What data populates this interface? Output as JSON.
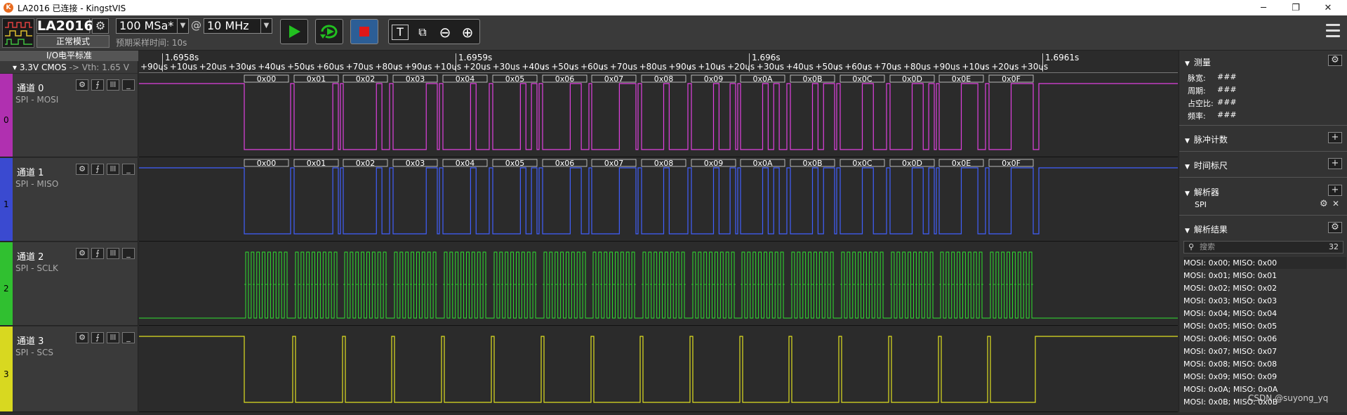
{
  "window": {
    "title": "LA2016 已连接 - KingstVIS",
    "app_icon_glyph": "K",
    "minimize": "─",
    "maximize": "❐",
    "close": "✕"
  },
  "device": {
    "name": "LA2016",
    "mode": "正常模式"
  },
  "sample": {
    "rate": "100 MSa*",
    "at": "@",
    "threshold_freq": "10 MHz",
    "duration_label": "预期采样时间: 10s"
  },
  "toolbar": {
    "play_color": "#22c020",
    "stop_color": "#e01818"
  },
  "io": {
    "title": "I/O电平标准",
    "standard": "3.3V CMOS",
    "vth": "-> Vth: 1.65 V"
  },
  "ruler": {
    "major": [
      "1.6958s",
      "1.6959s",
      "1.696s",
      "1.6961s"
    ],
    "minor": [
      "+90us",
      "+10us",
      "+20us",
      "+30us",
      "+40us",
      "+50us",
      "+60us",
      "+70us",
      "+80us",
      "+90us",
      "+10us",
      "+20us",
      "+30us",
      "+40us",
      "+50us",
      "+60us",
      "+70us",
      "+80us",
      "+90us",
      "+10us",
      "+20us",
      "+30us",
      "+40us",
      "+50us",
      "+60us",
      "+70us",
      "+80us",
      "+90us",
      "+10us",
      "+20us",
      "+30us"
    ]
  },
  "channels": [
    {
      "num": "0",
      "name": "通道 0",
      "proto": "SPI - MOSI",
      "color": "#e040e0",
      "strip": "#b030b0"
    },
    {
      "num": "1",
      "name": "通道 1",
      "proto": "SPI - MISO",
      "color": "#4060ff",
      "strip": "#3a4ad0"
    },
    {
      "num": "2",
      "name": "通道 2",
      "proto": "SPI - SCLK",
      "color": "#30e030",
      "strip": "#30c030"
    },
    {
      "num": "3",
      "name": "通道 3",
      "proto": "SPI - SCS",
      "color": "#e0e020",
      "strip": "#d8d820"
    }
  ],
  "decode_bytes": [
    "0x00",
    "0x01",
    "0x02",
    "0x03",
    "0x04",
    "0x05",
    "0x06",
    "0x07",
    "0x08",
    "0x09",
    "0x0A",
    "0x0B",
    "0x0C",
    "0x0D",
    "0x0E",
    "0x0F"
  ],
  "panel": {
    "measure": {
      "title": "测量",
      "labels": [
        "脉宽:",
        "周期:",
        "占空比:",
        "频率:"
      ],
      "values": [
        "###",
        "###",
        "###",
        "###"
      ]
    },
    "pulse_count": "脉冲计数",
    "time_ruler": "时间标尺",
    "analyzers": "解析器",
    "analyzer_item": "SPI",
    "results_title": "解析结果",
    "search_placeholder": "搜索",
    "result_count": "32",
    "results": [
      "MOSI: 0x00;  MISO: 0x00",
      "MOSI: 0x01;  MISO: 0x01",
      "MOSI: 0x02;  MISO: 0x02",
      "MOSI: 0x03;  MISO: 0x03",
      "MOSI: 0x04;  MISO: 0x04",
      "MOSI: 0x05;  MISO: 0x05",
      "MOSI: 0x06;  MISO: 0x06",
      "MOSI: 0x07;  MISO: 0x07",
      "MOSI: 0x08;  MISO: 0x08",
      "MOSI: 0x09;  MISO: 0x09",
      "MOSI: 0x0A;  MISO: 0x0A",
      "MOSI: 0x0B;  MISO: 0x0B"
    ]
  },
  "watermark": "CSDN @suyong_yq"
}
